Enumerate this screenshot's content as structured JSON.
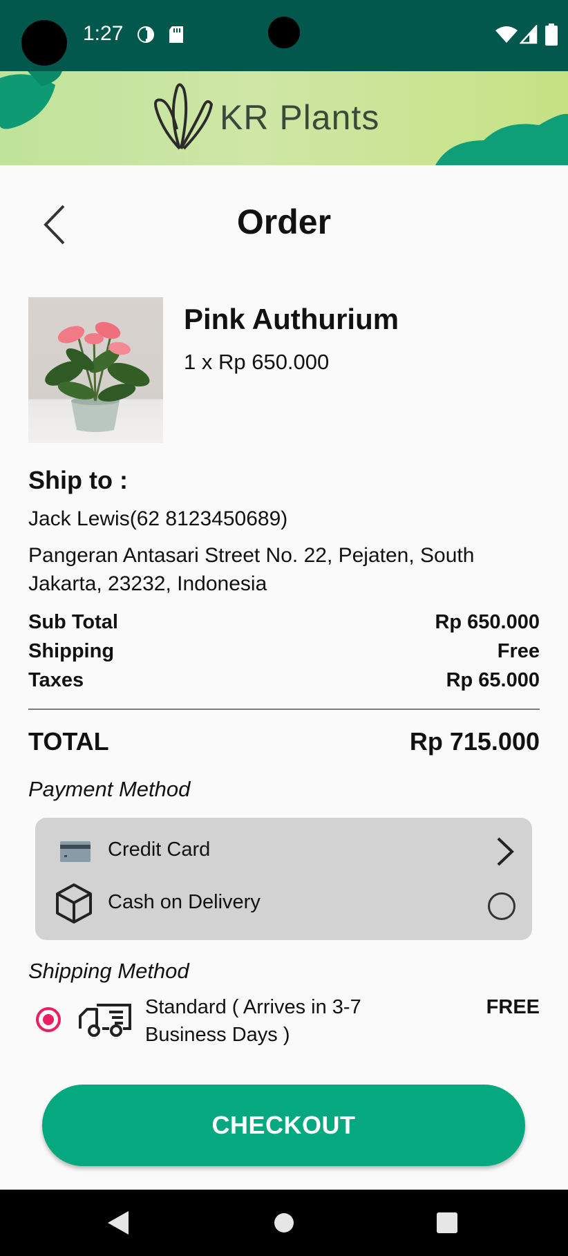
{
  "status_bar": {
    "time": "1:27"
  },
  "brand": {
    "name": "KR Plants"
  },
  "header": {
    "title": "Order"
  },
  "product": {
    "name": "Pink Authurium",
    "quantity_price": "1 x Rp 650.000"
  },
  "shipping_address": {
    "heading": "Ship to :",
    "recipient": "Jack Lewis(62 8123450689)",
    "address": "Pangeran Antasari Street No. 22, Pejaten, South Jakarta, 23232, Indonesia"
  },
  "summary": {
    "rows": [
      {
        "label": "Sub Total",
        "value": "Rp 650.000"
      },
      {
        "label": "Shipping",
        "value": "Free"
      },
      {
        "label": "Taxes",
        "value": "Rp 65.000"
      }
    ],
    "total_label": "TOTAL",
    "total_value": "Rp 715.000"
  },
  "payment": {
    "heading": "Payment Method",
    "options": [
      {
        "label": "Credit Card",
        "icon": "credit-card-icon",
        "control": "chevron-right-icon"
      },
      {
        "label": "Cash on Delivery",
        "icon": "box-icon",
        "control": "radio-unselected"
      }
    ]
  },
  "shipping_method": {
    "heading": "Shipping Method",
    "option_label": "Standard ( Arrives in 3-7 Business Days )",
    "price": "FREE",
    "selected": true
  },
  "checkout": {
    "label": "CHECKOUT"
  },
  "colors": {
    "status_bar": "#02584c",
    "accent": "#05a87f",
    "radio": "#e91e63"
  }
}
